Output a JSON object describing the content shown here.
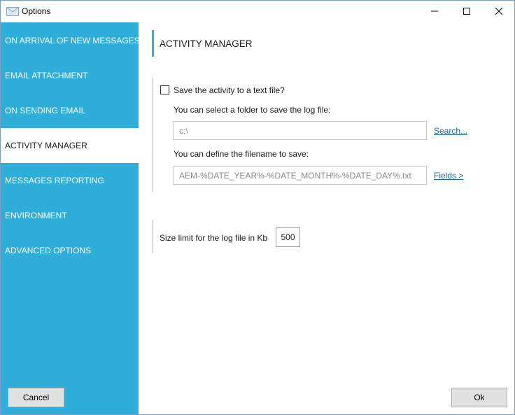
{
  "window": {
    "title": "Options",
    "icon": "envelope-icon",
    "controls": {
      "minimize": "minimize-icon",
      "maximize": "maximize-icon",
      "close": "close-icon"
    }
  },
  "sidebar": {
    "items": [
      {
        "label": "ON ARRIVAL OF NEW MESSAGES",
        "active": false
      },
      {
        "label": "EMAIL ATTACHMENT",
        "active": false
      },
      {
        "label": "ON SENDING EMAIL",
        "active": false
      },
      {
        "label": "ACTIVITY MANAGER",
        "active": true
      },
      {
        "label": "MESSAGES REPORTING",
        "active": false
      },
      {
        "label": "ENVIRONMENT",
        "active": false
      },
      {
        "label": "ADVANCED OPTIONS",
        "active": false
      }
    ],
    "cancel_label": "Cancel"
  },
  "main": {
    "title": "ACTIVITY MANAGER",
    "save_activity": {
      "checkbox_label": "Save the activity to a text file?",
      "checked": false,
      "folder_prompt": "You can select a folder to save the log file:",
      "folder_value": "c:\\",
      "search_link": "Search...",
      "filename_prompt": "You can define the filename to save:",
      "filename_value": "AEM-%DATE_YEAR%-%DATE_MONTH%-%DATE_DAY%.txt",
      "fields_link": "Fields >"
    },
    "size_limit": {
      "label": "Size limit for the log file in Kb",
      "value": "500"
    },
    "ok_label": "Ok"
  },
  "colors": {
    "sidebar_bg": "#2eaed8",
    "accent": "#2eaed8",
    "link": "#1a6aa6"
  }
}
